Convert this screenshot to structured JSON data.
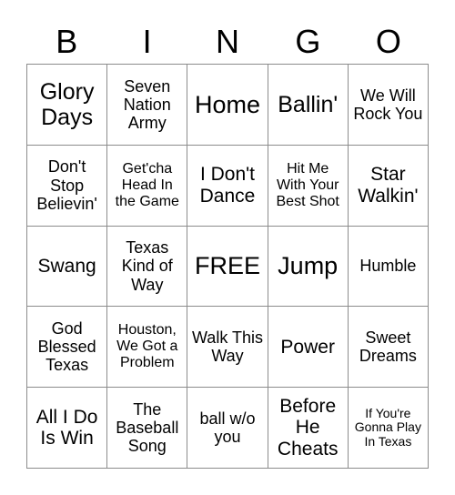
{
  "card": {
    "header_letters": [
      "B",
      "I",
      "N",
      "G",
      "O"
    ],
    "colors": {
      "page_background": "#ffffff",
      "cell_background": "#ffffff",
      "grid_line": "#8c8c8c",
      "text": "#000000"
    },
    "rows": [
      [
        {
          "label": "Glory Days",
          "size": "t-lg"
        },
        {
          "label": "Seven Nation Army",
          "size": "t-sm"
        },
        {
          "label": "Home",
          "size": "t-xl"
        },
        {
          "label": "Ballin'",
          "size": "t-lg"
        },
        {
          "label": "We Will Rock You",
          "size": "t-sm"
        }
      ],
      [
        {
          "label": "Don't Stop Believin'",
          "size": "t-sm"
        },
        {
          "label": "Get'cha Head In the Game",
          "size": "t-xs"
        },
        {
          "label": "I Don't Dance",
          "size": "t-md"
        },
        {
          "label": "Hit Me With Your Best Shot",
          "size": "t-xs"
        },
        {
          "label": "Star Walkin'",
          "size": "t-md"
        }
      ],
      [
        {
          "label": "Swang",
          "size": "t-md"
        },
        {
          "label": "Texas Kind of Way",
          "size": "t-sm"
        },
        {
          "label": "FREE",
          "size": "t-xl"
        },
        {
          "label": "Jump",
          "size": "t-xl"
        },
        {
          "label": "Humble",
          "size": "t-sm"
        }
      ],
      [
        {
          "label": "God Blessed Texas",
          "size": "t-sm"
        },
        {
          "label": "Houston, We Got a Problem",
          "size": "t-xs"
        },
        {
          "label": "Walk This Way",
          "size": "t-sm"
        },
        {
          "label": "Power",
          "size": "t-md"
        },
        {
          "label": "Sweet Dreams",
          "size": "t-sm"
        }
      ],
      [
        {
          "label": "All I Do Is Win",
          "size": "t-md"
        },
        {
          "label": "The Baseball Song",
          "size": "t-sm"
        },
        {
          "label": "ball w/o you",
          "size": "t-sm"
        },
        {
          "label": "Before He Cheats",
          "size": "t-md"
        },
        {
          "label": "If You're Gonna Play In Texas",
          "size": "t-xxs"
        }
      ]
    ]
  }
}
